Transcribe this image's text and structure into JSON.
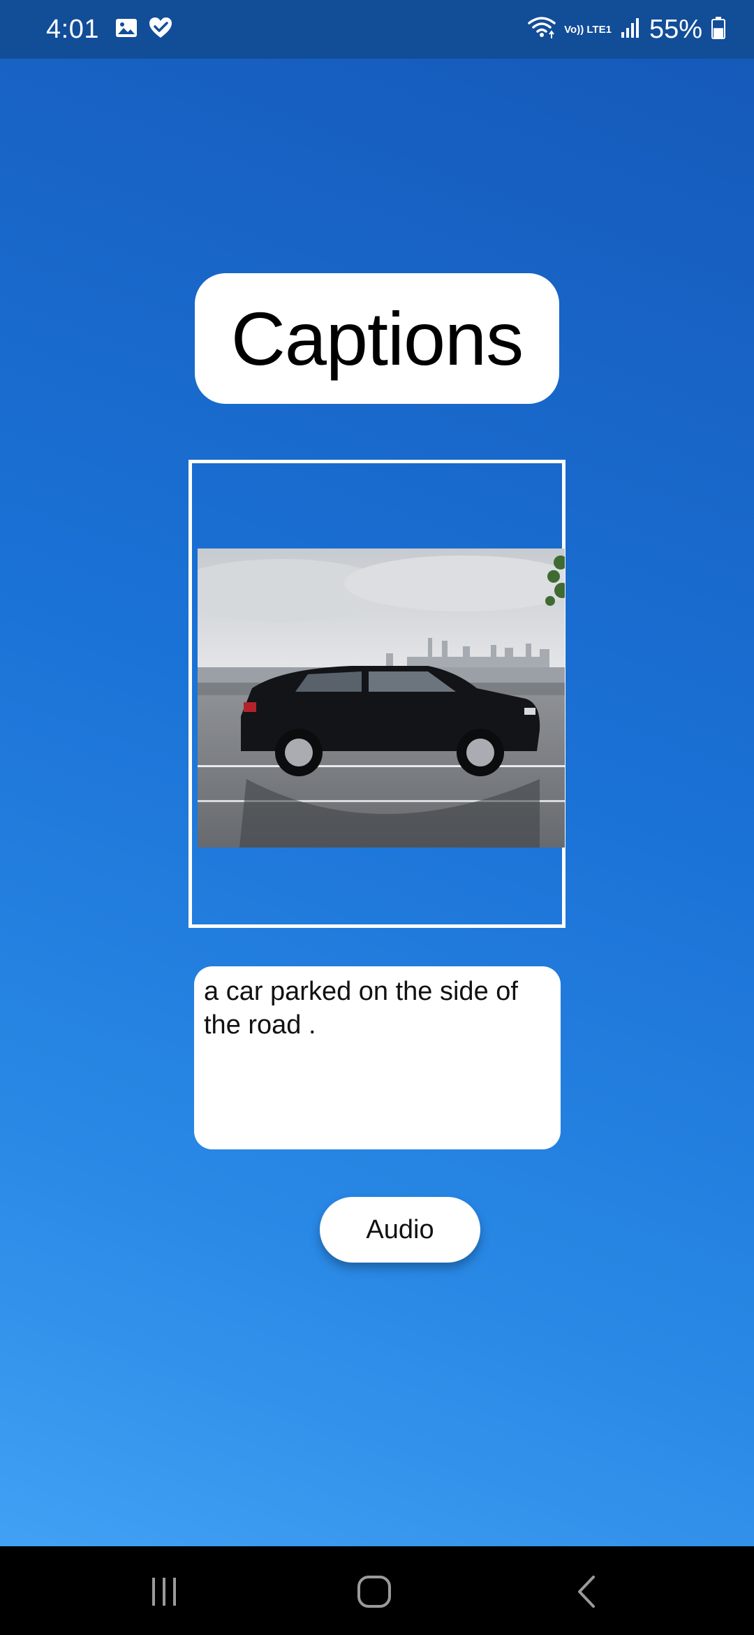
{
  "status_bar": {
    "time": "4:01",
    "left_icons": [
      "gallery-icon",
      "health-icon"
    ],
    "network_label": "Vo)) LTE1",
    "battery_percent": "55%",
    "battery_level": 0.55,
    "right_icons": [
      "wifi-icon",
      "volte-icon",
      "signal-icon",
      "battery-icon"
    ]
  },
  "app": {
    "title": "Captions",
    "caption": "a car parked on the side of the road .",
    "audio_button_label": "Audio",
    "image_alt_description_icon": "photo-icon"
  },
  "nav_bar": {
    "icons": [
      "recent-apps-icon",
      "home-icon",
      "back-icon"
    ]
  },
  "colors": {
    "status_bar": "#124d98",
    "background_top": "#1558b8",
    "background_bottom": "#46a6f7",
    "card": "#ffffff",
    "nav_bar": "#000000"
  }
}
